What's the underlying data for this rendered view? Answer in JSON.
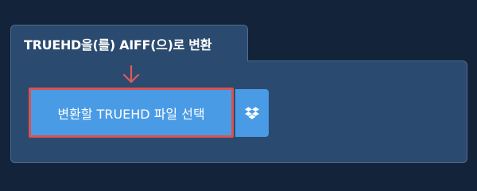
{
  "panel": {
    "title": "TRUEHD을(를) AIFF(으)로 변환"
  },
  "file_button": {
    "label": "변환할 TRUEHD 파일 선택"
  },
  "icons": {
    "arrow": "arrow-down-icon",
    "dropbox": "dropbox-icon"
  },
  "colors": {
    "background": "#13233a",
    "panel": "#2b4a6f",
    "button": "#4a9be6",
    "highlight": "#d9534f"
  }
}
